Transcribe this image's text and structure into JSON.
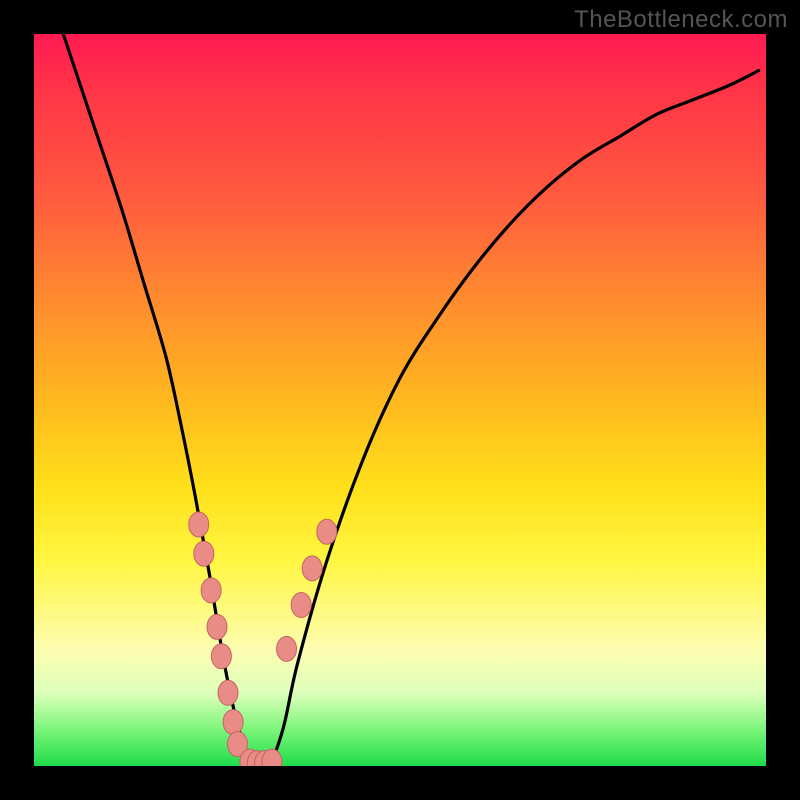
{
  "watermark": "TheBottleneck.com",
  "chart_data": {
    "type": "line",
    "title": "",
    "xlabel": "",
    "ylabel": "",
    "ylim": [
      0,
      100
    ],
    "xlim": [
      0,
      100
    ],
    "series": [
      {
        "name": "bottleneck-curve",
        "x": [
          4,
          8,
          12,
          15,
          18,
          20,
          22,
          24,
          26,
          28,
          30,
          32,
          34,
          36,
          40,
          45,
          50,
          55,
          60,
          65,
          70,
          75,
          80,
          85,
          90,
          95,
          99
        ],
        "y": [
          100,
          88,
          76,
          66,
          56,
          47,
          37,
          26,
          14,
          5,
          0,
          0,
          5,
          14,
          28,
          42,
          53,
          61,
          68,
          74,
          79,
          83,
          86,
          89,
          91,
          93,
          95
        ]
      }
    ],
    "markers": [
      {
        "name": "left-cluster",
        "x": [
          22.5,
          23.2,
          24.2,
          25.0,
          25.6,
          26.5,
          27.2,
          27.8
        ],
        "y": [
          33,
          29,
          24,
          19,
          15,
          10,
          6,
          3
        ]
      },
      {
        "name": "right-cluster",
        "x": [
          34.5,
          36.5,
          38.0,
          40.0
        ],
        "y": [
          16,
          22,
          27,
          32
        ]
      },
      {
        "name": "bottom-cluster",
        "x": [
          29.5,
          30.5,
          31.5,
          32.5
        ],
        "y": [
          0.6,
          0.4,
          0.4,
          0.6
        ]
      }
    ],
    "colors": {
      "curve": "#000000",
      "marker_fill": "#e98b87",
      "marker_stroke": "#c46561"
    }
  }
}
